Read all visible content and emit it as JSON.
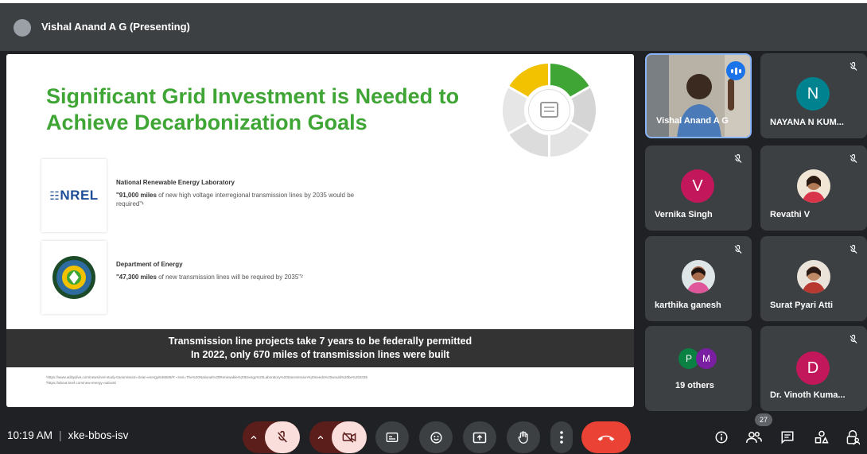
{
  "presenting": {
    "label": "Vishal Anand A G (Presenting)"
  },
  "slide": {
    "title": "Significant Grid Investment is Needed to Achieve Decarbonization Goals",
    "sources": [
      {
        "logo_text": "NREL",
        "name": "National Renewable Energy Laboratory",
        "quote_bold": "\"91,000 miles",
        "quote_rest": " of new high voltage interregional transmission lines by 2035 would be required\"¹"
      },
      {
        "name": "Department of Energy",
        "quote_bold": "\"47,300 miles",
        "quote_rest": " of new transmission lines will be required by 2035\"²"
      }
    ],
    "banner_line1": "Transmission line projects take 7 years to be federally permitted",
    "banner_line2": "In 2022, only 670 miles of transmission lines were built",
    "footnote1": "¹https://www.utilitydive.com/news/nrel-study-transmission-clean-energy/646589/#:~:text=The%20National%20Renewable%20Energy%20Laboratory%20transmission%20needs%20would%20be%202035",
    "footnote2": "²https://about.bnef.com/new-energy-outlook/"
  },
  "participants": [
    {
      "name": "Vishal Anand A G",
      "type": "video",
      "speaking": true
    },
    {
      "name": "NAYANA N KUM...",
      "initial": "N",
      "color": "#00838f",
      "muted": true
    },
    {
      "name": "Vernika Singh",
      "initial": "V",
      "color": "#c2185b",
      "muted": true
    },
    {
      "name": "Revathi V",
      "type": "photo",
      "muted": true
    },
    {
      "name": "karthika ganesh",
      "type": "photo",
      "muted": true
    },
    {
      "name": "Surat Pyari Atti",
      "type": "photo",
      "muted": true
    },
    {
      "name": "19 others",
      "initials": [
        "P",
        "M"
      ],
      "colors": [
        "#0b8043",
        "#7b1fa2"
      ]
    },
    {
      "name": "Dr. Vinoth Kuma...",
      "initial": "D",
      "color": "#c2185b",
      "muted": true
    }
  ],
  "meeting": {
    "time": "10:19 AM",
    "code": "xke-bbos-isv",
    "participant_count": "27"
  },
  "colors": {
    "accent_green": "#3fa535",
    "end_call": "#ea4335",
    "mic_off_bg": "#f9dedc"
  }
}
